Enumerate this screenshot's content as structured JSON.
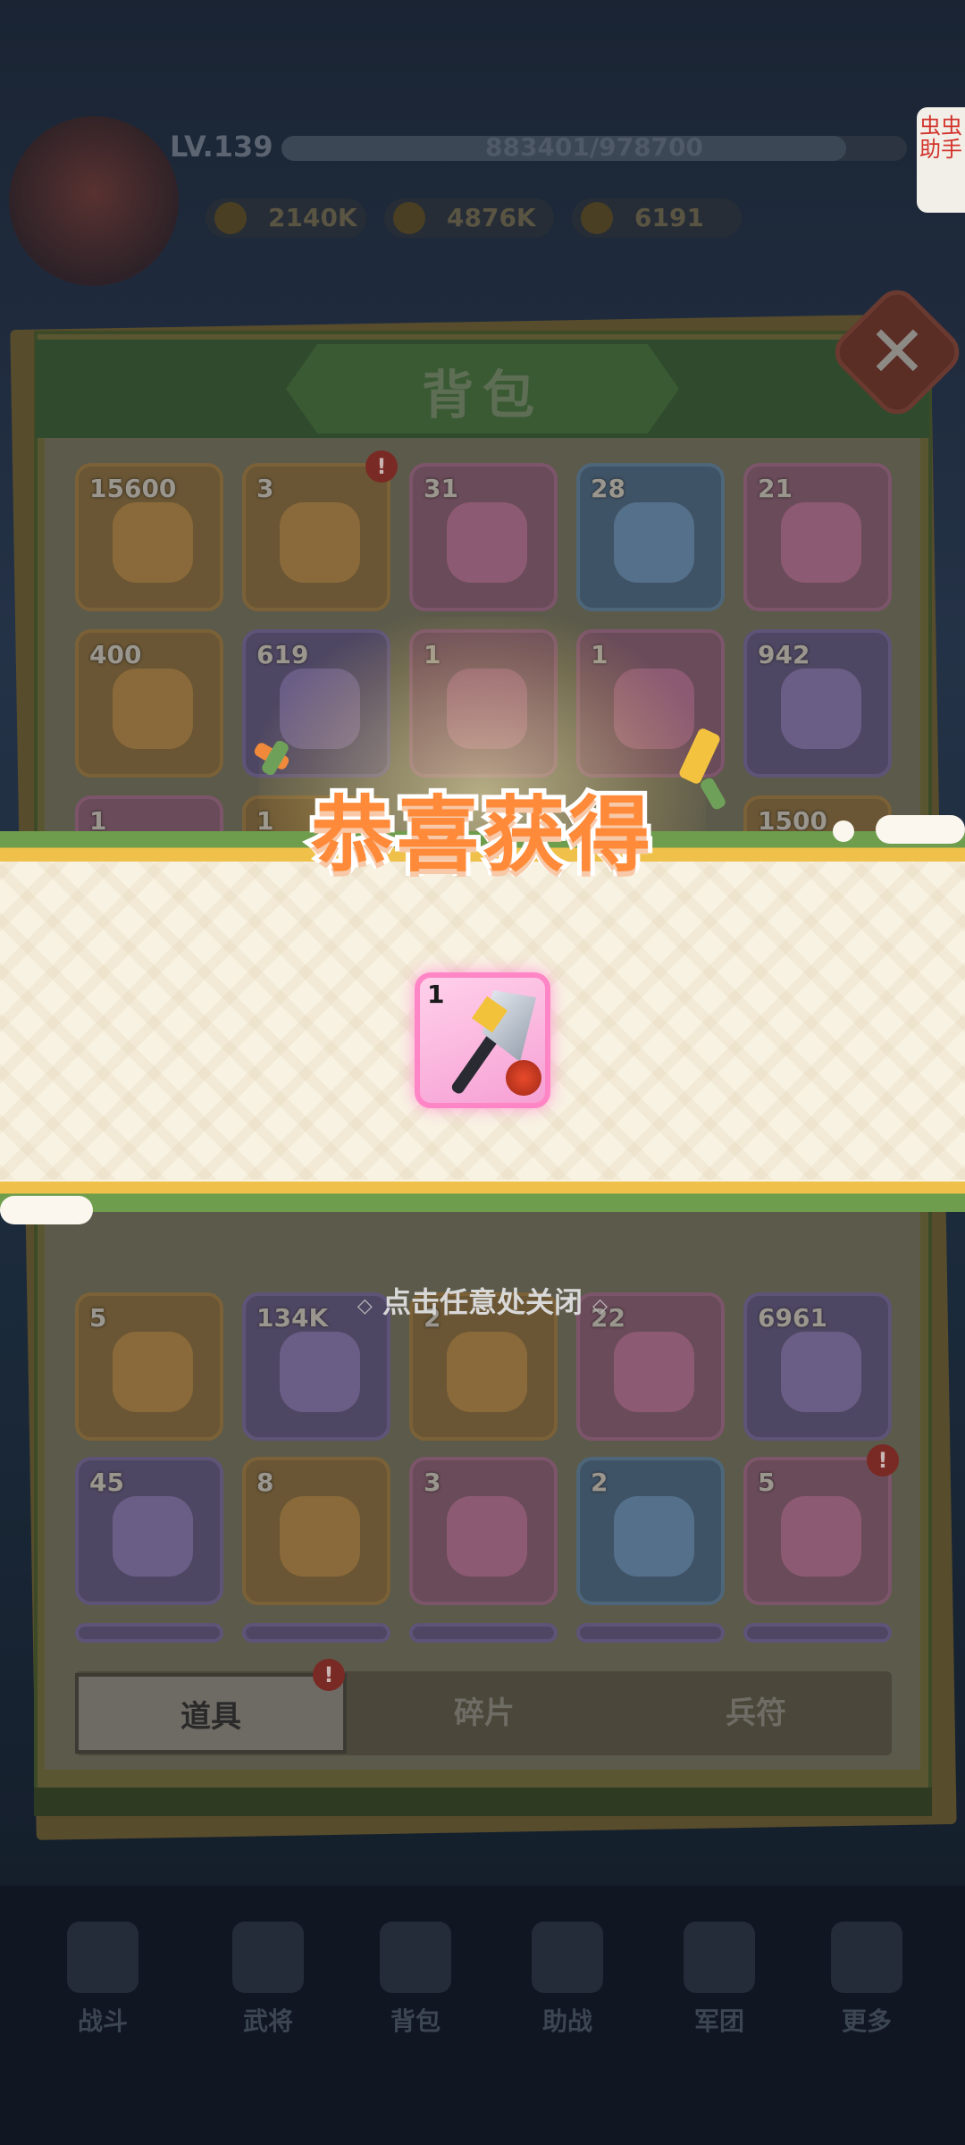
{
  "header": {
    "level": "LV.139",
    "xp": "883401/978700",
    "xp_progress": 0.903,
    "resources": [
      {
        "icon": "power-icon",
        "value": "2140K"
      },
      {
        "icon": "gold-coin-icon",
        "value": "4876K"
      },
      {
        "icon": "ingot-icon",
        "value": "6191"
      }
    ],
    "helper_label": "虫虫助手"
  },
  "bag": {
    "title": "背包",
    "close_icon": "close-icon",
    "grid_rows": [
      [
        {
          "count": "15600",
          "frame": "orange",
          "icon": "star-icon"
        },
        {
          "count": "3",
          "frame": "orange",
          "icon": "fan-box-icon",
          "alert": true
        },
        {
          "count": "31",
          "frame": "pink",
          "icon": "gem-icon"
        },
        {
          "count": "28",
          "frame": "blue",
          "icon": "gem-icon"
        },
        {
          "count": "21",
          "frame": "pink",
          "icon": "crystal-icon"
        }
      ],
      [
        {
          "count": "400",
          "frame": "orange",
          "icon": "crystal-icon"
        },
        {
          "count": "619",
          "frame": "purple",
          "icon": "crystal-icon"
        },
        {
          "count": "1",
          "frame": "pink",
          "icon": "gem-icon"
        },
        {
          "count": "1",
          "frame": "pink",
          "icon": "hammer-icon"
        },
        {
          "count": "942",
          "frame": "purple",
          "icon": "orbs-icon"
        }
      ],
      [
        {
          "count": "5",
          "frame": "orange",
          "icon": "egg-icon"
        },
        {
          "count": "134K",
          "frame": "purple",
          "icon": "peach-icon"
        },
        {
          "count": "2",
          "frame": "orange",
          "icon": "gold-pile-icon"
        },
        {
          "count": "22",
          "frame": "pink",
          "icon": "jade-icon"
        },
        {
          "count": "6961",
          "frame": "purple",
          "icon": "key-icon"
        }
      ],
      [
        {
          "count": "45",
          "frame": "purple",
          "icon": "fruit-icon"
        },
        {
          "count": "8",
          "frame": "orange",
          "icon": "fruit-icon"
        },
        {
          "count": "3",
          "frame": "pink",
          "icon": "fruit-icon"
        },
        {
          "count": "2",
          "frame": "blue",
          "icon": "fruit-icon"
        },
        {
          "count": "5",
          "frame": "pink",
          "icon": "treasure-box-icon",
          "alert": true
        }
      ]
    ],
    "partial_counts": {
      "left": "1",
      "mid": "1",
      "right": "1500"
    },
    "tabs": [
      {
        "label": "道具",
        "active": true,
        "alert": true
      },
      {
        "label": "碎片",
        "active": false
      },
      {
        "label": "兵符",
        "active": false
      }
    ]
  },
  "reward_popup": {
    "title": "恭喜获得",
    "item": {
      "count": "1",
      "icon": "axe-icon"
    },
    "hint": "点击任意处关闭"
  },
  "nav": {
    "items": [
      {
        "label": "战斗",
        "icon": "battle-icon"
      },
      {
        "label": "武将",
        "icon": "general-icon"
      },
      {
        "label": "背包",
        "icon": "bag-icon"
      },
      {
        "label": "助战",
        "icon": "assist-icon"
      },
      {
        "label": "军团",
        "icon": "legion-icon"
      },
      {
        "label": "更多",
        "icon": "more-icon"
      }
    ]
  },
  "colors": {
    "accent_orange": "#ff8a3a",
    "banner_green": "#6f9d4e",
    "banner_gold": "#f0c14a",
    "reward_pink": "#ff86c6"
  }
}
